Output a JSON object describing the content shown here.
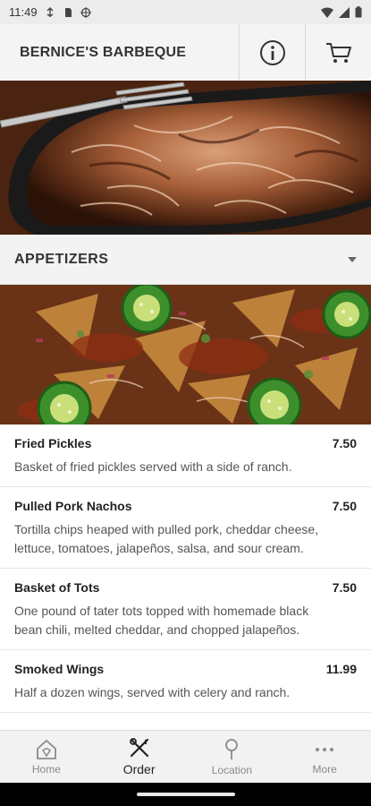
{
  "status_bar": {
    "time": "11:49"
  },
  "header": {
    "title": "BERNICE'S BARBEQUE",
    "info_icon": "info-icon",
    "cart_icon": "cart-icon"
  },
  "category": {
    "title": "APPETIZERS"
  },
  "menu_items": [
    {
      "name": "Fried Pickles",
      "price": "7.50",
      "description": "Basket of fried pickles served with a side of ranch."
    },
    {
      "name": "Pulled Pork Nachos",
      "price": "7.50",
      "description": "Tortilla chips heaped with pulled pork, cheddar cheese, lettuce, tomatoes, jalapeños, salsa, and sour cream."
    },
    {
      "name": "Basket of Tots",
      "price": "7.50",
      "description": "One pound of tater tots topped with homemade black bean chili, melted cheddar, and chopped jalapeños."
    },
    {
      "name": "Smoked Wings",
      "price": "11.99",
      "description": "Half a dozen wings, served with celery and ranch."
    }
  ],
  "bottom_nav": {
    "items": [
      {
        "label": "Home",
        "icon": "home-icon"
      },
      {
        "label": "Order",
        "icon": "utensils-icon"
      },
      {
        "label": "Location",
        "icon": "location-pin-icon"
      },
      {
        "label": "More",
        "icon": "more-dots-icon"
      }
    ],
    "active": "Order"
  },
  "colors": {
    "header_bg": "#f4f4f4",
    "text_dark": "#222222",
    "nav_inactive": "#8a8a8a"
  }
}
